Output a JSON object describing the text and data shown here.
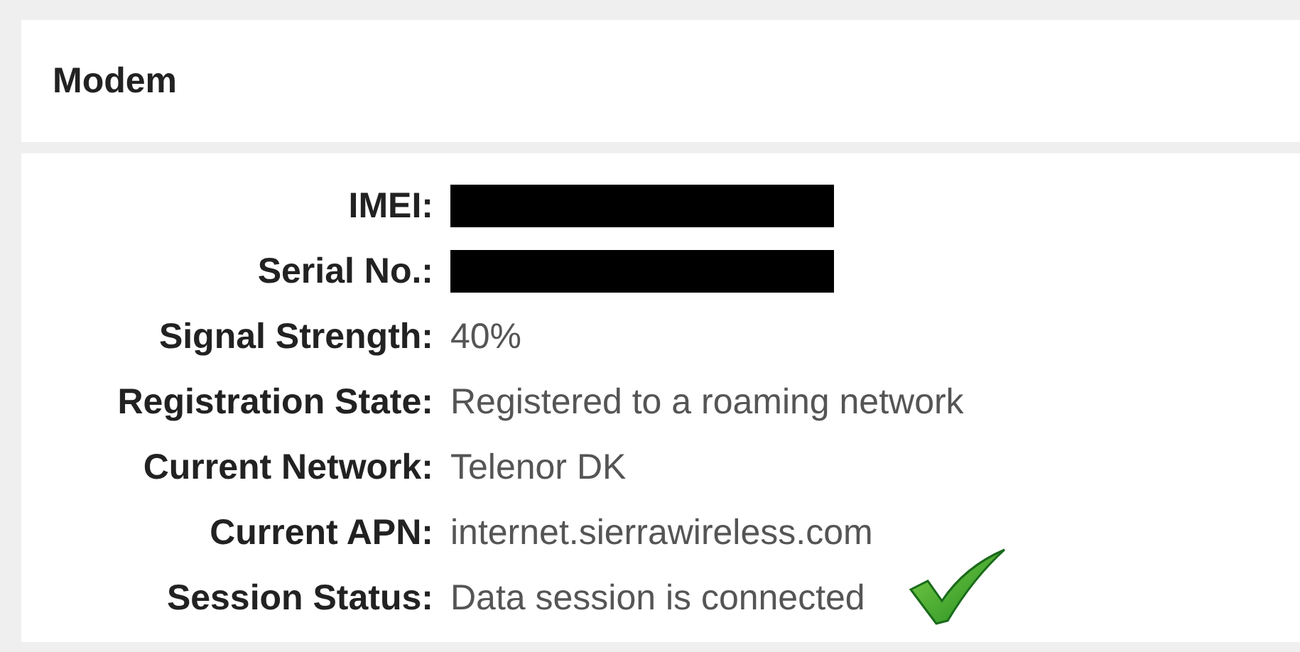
{
  "panel": {
    "title": "Modem"
  },
  "fields": [
    {
      "label": "IMEI:",
      "kind": "redacted"
    },
    {
      "label": "Serial No.:",
      "kind": "redacted"
    },
    {
      "label": "Signal Strength:",
      "kind": "text",
      "value": "40%"
    },
    {
      "label": "Registration State:",
      "kind": "text",
      "value": "Registered to a roaming network"
    },
    {
      "label": "Current Network:",
      "kind": "text",
      "value": "Telenor DK"
    },
    {
      "label": "Current APN:",
      "kind": "text",
      "value": "internet.sierrawireless.com"
    },
    {
      "label": "Session Status:",
      "kind": "status",
      "value": "Data session is connected"
    }
  ]
}
